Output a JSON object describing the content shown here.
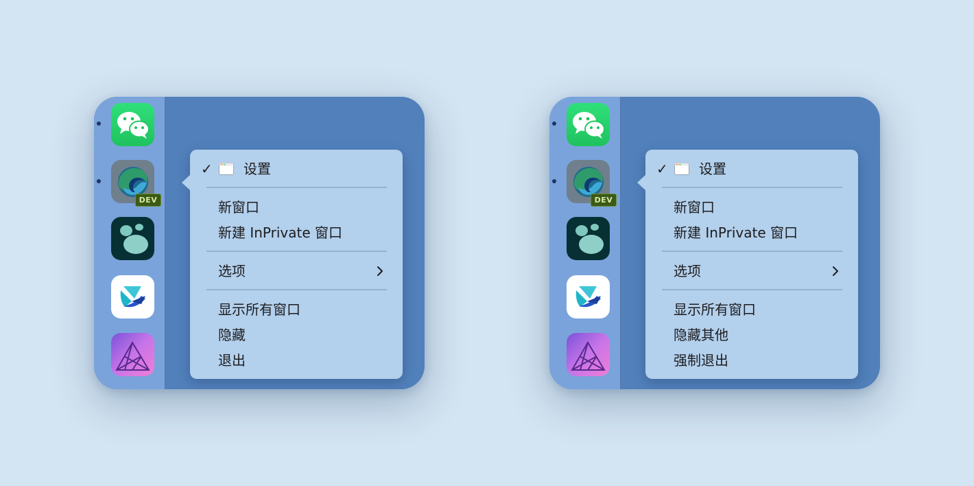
{
  "panels": [
    {
      "menu": {
        "title": "设置",
        "new_window": "新窗口",
        "new_inprivate": "新建 InPrivate 窗口",
        "options": "选项",
        "show_all": "显示所有窗口",
        "hide": "隐藏",
        "quit": "退出"
      }
    },
    {
      "menu": {
        "title": "设置",
        "new_window": "新窗口",
        "new_inprivate": "新建 InPrivate 窗口",
        "options": "选项",
        "show_all": "显示所有窗口",
        "hide": "隐藏其他",
        "quit": "强制退出"
      }
    }
  ],
  "dock_apps": [
    {
      "name": "wechat-icon",
      "running": true
    },
    {
      "name": "edge-dev-icon",
      "running": true,
      "badge": "DEV"
    },
    {
      "name": "app3-icon",
      "running": false
    },
    {
      "name": "lark-icon",
      "running": false
    },
    {
      "name": "affinity-photo-icon",
      "running": false
    }
  ],
  "colors": {
    "background": "#d3e4f2",
    "panel": "#5180bb",
    "dock": "#7aa3db",
    "menu": "#b3d0ec",
    "wechat_green": "#25d366",
    "affinity_purple": "#c774e8"
  }
}
